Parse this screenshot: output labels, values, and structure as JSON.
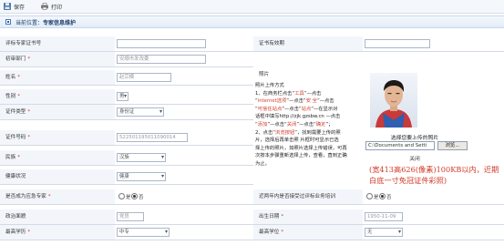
{
  "toolbar": {
    "save_label": "保存",
    "print_label": "打印"
  },
  "breadcrumb": {
    "prefix": "当前位置：",
    "current": "专家信息维护"
  },
  "form": {
    "cert_no": {
      "label": "评标专家证书号",
      "value": ""
    },
    "cert_valid": {
      "label": "证书有效期",
      "value": ""
    },
    "dept": {
      "label": "初审部门",
      "value": "安顺市发改委"
    },
    "name": {
      "label": "姓名",
      "value": "赵宗模"
    },
    "gender": {
      "label": "性别",
      "value": "男"
    },
    "id_type": {
      "label": "证件类型",
      "value": "身份证"
    },
    "id_no": {
      "label": "证件号码",
      "value": "522501195011090014"
    },
    "nation": {
      "label": "民族",
      "value": "汉族"
    },
    "health": {
      "label": "健康状况",
      "value": "健康"
    },
    "emergency": {
      "label": "是否成为应急专家",
      "options": [
        "是",
        "否"
      ],
      "selected": "否"
    },
    "training": {
      "label": "近两年内是否接受过评标业务培训",
      "options": [
        "是",
        "否"
      ],
      "selected": "否"
    },
    "politics": {
      "label": "政治面貌",
      "value": "党员"
    },
    "birth": {
      "label": "出生日期",
      "value": "1950-11-09"
    },
    "education": {
      "label": "最高学历",
      "value": "中专"
    },
    "degree": {
      "label": "最高学位",
      "value": "无"
    },
    "photo_label": "照片"
  },
  "instructions": {
    "title": "照片上传方式",
    "l1a": "1、在商务栏点击“",
    "l1b": "工具",
    "l1c": "”—点击",
    "l2a": "“",
    "l2b": "internet选项",
    "l2c": "”—点击“",
    "l2d": "安 全",
    "l2e": "”—点击",
    "l3a": "“",
    "l3b": "可信任站点",
    "l3c": "”—点击“",
    "l3d": "站点",
    "l3e": "”—在显示对",
    "l4": "话框中填写http://zjk.gzsbw.cn —点击",
    "l5a": "“",
    "l5b": "添加",
    "l5c": "”—点击“",
    "l5d": "关闭",
    "l5e": "”—点击“",
    "l5f": "确定",
    "l5g": "”；",
    "l6a": "2、点击“",
    "l6b": "浏览按钮",
    "l6c": "”，找到需要上传的照",
    "l7": "片，选择后再单击照 片框时可显示已选",
    "l8": "择上传的照片，如照片选择上传错误，可再",
    "l9": "次按本步骤重新选择上传，查看，直到正确",
    "l10": "为止。"
  },
  "upload": {
    "prompt": "选择您要上传的照片",
    "path": "C:\\Documents and Setti",
    "browse": "浏览...",
    "close": "关闭",
    "note": "(宽413高626(像素)100KB以内，近期白底一寸免冠证件彩照)"
  },
  "colors": {
    "required": "#d23a2a",
    "label_bg": "#f2f6fb",
    "border": "#d3dbe6"
  }
}
